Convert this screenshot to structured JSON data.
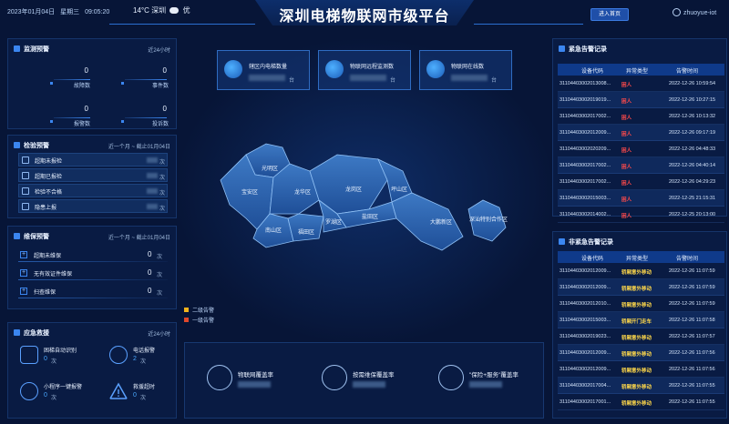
{
  "header": {
    "date": "2023年01月04日",
    "weekday": "星期三",
    "time": "09:05:20",
    "temperature": "14°C",
    "city": "深圳",
    "air_quality": "优",
    "title": "深圳电梯物联网市级平台",
    "home_button": "进入首页",
    "username": "zhuoyue-iot"
  },
  "monitor": {
    "title": "监测预警",
    "range": "近24小时",
    "stats": [
      {
        "label": "故障数",
        "value": "0"
      },
      {
        "label": "事件数",
        "value": "0"
      },
      {
        "label": "报警数",
        "value": "0"
      },
      {
        "label": "投诉数",
        "value": "0"
      }
    ]
  },
  "inspection": {
    "title": "检验预警",
    "range": "近一个月 ~ 截止01月04日",
    "unit": "次",
    "items": [
      {
        "label": "超期未报检",
        "icon": "calendar-icon"
      },
      {
        "label": "超期已报检",
        "icon": "calendar-icon"
      },
      {
        "label": "检验不合格",
        "icon": "document-icon"
      },
      {
        "label": "隐患上报",
        "icon": "warning-icon"
      }
    ]
  },
  "maintenance": {
    "title": "维保预警",
    "range": "近一个月 ~ 截止01月04日",
    "unit": "次",
    "items": [
      {
        "label": "超期未维保",
        "value": "0"
      },
      {
        "label": "无有效证件维保",
        "value": "0"
      },
      {
        "label": "扫查维保",
        "value": "0"
      }
    ]
  },
  "emergency": {
    "title": "应急救援",
    "range": "近24小时",
    "unit": "次",
    "items": [
      {
        "label": "困梯自动识别",
        "value": "0",
        "icon": "person-scan-icon"
      },
      {
        "label": "电话报警",
        "value": "2",
        "icon": "phone-icon"
      },
      {
        "label": "小程序一键报警",
        "value": "0",
        "icon": "link-icon"
      },
      {
        "label": "救援超时",
        "value": "0",
        "icon": "warning-icon"
      }
    ]
  },
  "cards": {
    "unit": "台",
    "items": [
      {
        "label": "辖区内电梯数量"
      },
      {
        "label": "物联网远程监测数"
      },
      {
        "label": "物联网在线数"
      }
    ]
  },
  "map": {
    "districts": [
      "光明区",
      "宝安区",
      "龙华区",
      "龙岗区",
      "坪山区",
      "南山区",
      "福田区",
      "罗湖区",
      "盐田区",
      "大鹏新区",
      "深汕特别合作区"
    ],
    "legend": [
      {
        "label": "二级告警",
        "color": "#f2b21c"
      },
      {
        "label": "一级告警",
        "color": "#e0482b"
      }
    ]
  },
  "coverage": {
    "items": [
      {
        "label": "物联网覆盖率",
        "icon": "book-check-icon"
      },
      {
        "label": "按需维保覆盖率",
        "icon": "gauge-icon"
      },
      {
        "label": "\"保险+服务\"覆盖率",
        "icon": "hand-money-icon"
      }
    ]
  },
  "emergency_alarms": {
    "title": "紧急告警记录",
    "columns": [
      "设备代码",
      "异常类型",
      "告警时间"
    ],
    "rows": [
      [
        "31104403002013008...",
        "困人",
        "2022-12-26 10:59:54"
      ],
      [
        "31104403002019019...",
        "困人",
        "2022-12-26 10:27:15"
      ],
      [
        "31104403002017002...",
        "困人",
        "2022-12-26 10:13:32"
      ],
      [
        "31104403002012009...",
        "困人",
        "2022-12-26 09:17:19"
      ],
      [
        "31104403002020209...",
        "困人",
        "2022-12-26 04:48:33"
      ],
      [
        "31104403002017002...",
        "困人",
        "2022-12-26 04:40:14"
      ],
      [
        "31104403002017002...",
        "困人",
        "2022-12-26 04:29:23"
      ],
      [
        "31104403002015003...",
        "困人",
        "2022-12-25 21:15:31"
      ],
      [
        "31104403002014002...",
        "困人",
        "2022-12-25 20:13:00"
      ]
    ]
  },
  "non_emergency_alarms": {
    "title": "非紧急告警记录",
    "columns": [
      "设备代码",
      "异常类型",
      "告警时间"
    ],
    "rows": [
      [
        "31104403002012009...",
        "轿厢意外移动",
        "2022-12-26 11:07:59"
      ],
      [
        "31104403002012009...",
        "轿厢意外移动",
        "2022-12-26 11:07:59"
      ],
      [
        "31104403002012010...",
        "轿厢意外移动",
        "2022-12-26 11:07:59"
      ],
      [
        "31104403002015003...",
        "轿厢开门走车",
        "2022-12-26 11:07:58"
      ],
      [
        "31104403002019023...",
        "轿厢意外移动",
        "2022-12-26 11:07:57"
      ],
      [
        "31104403002012009...",
        "轿厢意外移动",
        "2022-12-26 11:07:56"
      ],
      [
        "31104403002012009...",
        "轿厢意外移动",
        "2022-12-26 11:07:56"
      ],
      [
        "31104403002017004...",
        "轿厢意外移动",
        "2022-12-26 11:07:55"
      ],
      [
        "31104403002017001...",
        "轿厢意外移动",
        "2022-12-26 11:07:55"
      ]
    ]
  }
}
